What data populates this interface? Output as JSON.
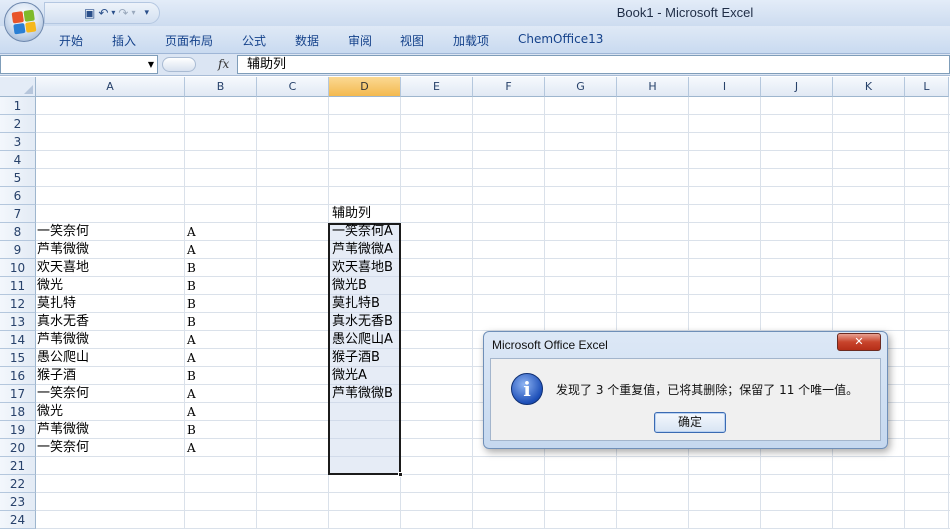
{
  "window": {
    "title": "Book1 - Microsoft Excel"
  },
  "ribbon": {
    "tabs": [
      "开始",
      "插入",
      "页面布局",
      "公式",
      "数据",
      "审阅",
      "视图",
      "加载项",
      "ChemOffice13"
    ]
  },
  "formula_bar": {
    "name_box": "",
    "fx": "fx",
    "content": "辅助列"
  },
  "grid": {
    "columns": [
      "A",
      "B",
      "C",
      "D",
      "E",
      "F",
      "G",
      "H",
      "I",
      "J",
      "K",
      "L"
    ],
    "selected_column": "D",
    "rows": [
      "1",
      "2",
      "3",
      "4",
      "5",
      "6",
      "7",
      "8",
      "9",
      "10",
      "11",
      "12",
      "13",
      "14",
      "15",
      "16",
      "17",
      "18",
      "19",
      "20",
      "21",
      "22",
      "23",
      "24"
    ],
    "column_a": [
      "一笑奈何",
      "芦苇微微",
      "欢天喜地",
      "微光",
      "莫扎特",
      "真水无香",
      "芦苇微微",
      "愚公爬山",
      "猴子酒",
      "一笑奈何",
      "微光",
      "芦苇微微",
      "一笑奈何"
    ],
    "column_b": [
      "A",
      "A",
      "B",
      "B",
      "B",
      "B",
      "A",
      "A",
      "B",
      "A",
      "A",
      "B",
      "A"
    ],
    "column_d_header": "辅助列",
    "column_d": [
      "一笑奈何A",
      "芦苇微微A",
      "欢天喜地B",
      "微光B",
      "莫扎特B",
      "真水无香B",
      "愚公爬山A",
      "猴子酒B",
      "微光A",
      "芦苇微微B"
    ]
  },
  "dialog": {
    "title": "Microsoft Office Excel",
    "close": "✕",
    "icon": "i",
    "message": "发现了 3 个重复值，已将其删除；保留了 11 个唯一值。",
    "ok": "确定"
  }
}
